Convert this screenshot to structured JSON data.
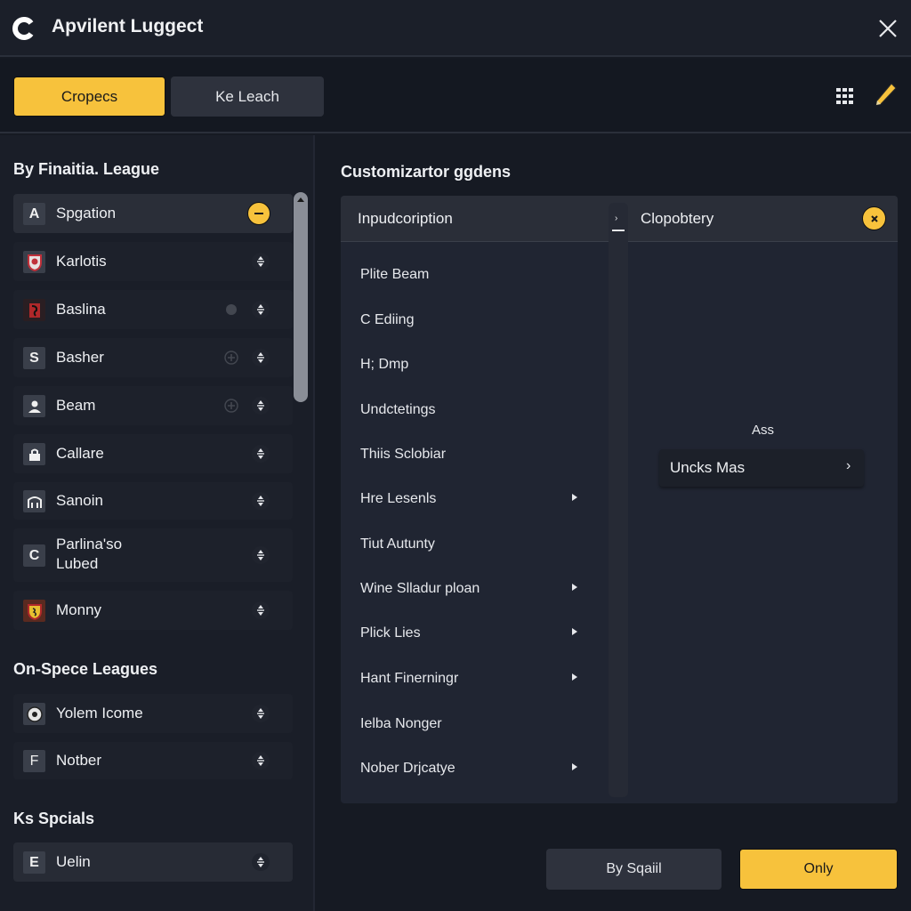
{
  "window": {
    "title": "Apvilent Luggect",
    "logo_icon": "c-logo-icon",
    "close_icon": "close-icon"
  },
  "toolbar": {
    "tabs": [
      {
        "label": "Cropecs",
        "active": true
      },
      {
        "label": "Ke Leach",
        "active": false
      }
    ],
    "grid_icon": "grid-icon",
    "edit_icon": "pencil-icon"
  },
  "sidebar": {
    "sections": [
      {
        "title": "By Finaitia. League",
        "items": [
          {
            "icon": "A",
            "label": "Spgation",
            "selected": true,
            "action": "remove"
          },
          {
            "icon": "crest-red",
            "label": "Karlotis",
            "action": "reorder"
          },
          {
            "icon": "crest-dragon",
            "label": "Baslina",
            "action": "reorder",
            "faint_icon": true
          },
          {
            "icon": "S",
            "label": "Basher",
            "action": "reorder",
            "faint_icon": true
          },
          {
            "icon": "person",
            "label": "Beam",
            "action": "reorder",
            "faint_icon": true
          },
          {
            "icon": "lock",
            "label": "Callare",
            "action": "reorder"
          },
          {
            "icon": "arch",
            "label": "Sanoin",
            "action": "reorder"
          },
          {
            "icon": "C",
            "label": "Parlina'so Lubed",
            "action": "reorder"
          },
          {
            "icon": "crest-yellow",
            "label": "Monny",
            "action": "reorder"
          }
        ]
      },
      {
        "title": "On-Spece Leagues",
        "items": [
          {
            "icon": "ball",
            "label": "Yolem Icome",
            "action": "reorder"
          },
          {
            "icon": "F",
            "label": "Notber",
            "action": "reorder"
          }
        ]
      },
      {
        "title": "Ks Spcials",
        "items": [
          {
            "icon": "E",
            "label": "Uelin",
            "action": "reorder"
          }
        ]
      }
    ]
  },
  "main": {
    "title": "Customizartor ggdens",
    "left_column_header": "Inpudcoription",
    "right_column_header": "Clopobtery",
    "options": [
      {
        "label": "Plite Beam",
        "submenu": false
      },
      {
        "label": "C Ediing",
        "submenu": false
      },
      {
        "label": "H; Dmp",
        "submenu": false
      },
      {
        "label": "Undctetings",
        "submenu": false
      },
      {
        "label": "Thiis Sclobiar",
        "submenu": false
      },
      {
        "label": "Hre Lesenls",
        "submenu": true
      },
      {
        "label": "Tiut Autunty",
        "submenu": false
      },
      {
        "label": "Wine Slladur ploan",
        "submenu": true
      },
      {
        "label": "Plick Lies",
        "submenu": true
      },
      {
        "label": "Hant Finerningr",
        "submenu": true
      },
      {
        "label": "Ielba Nonger",
        "submenu": false
      },
      {
        "label": "Nober Drjcatye",
        "submenu": true
      }
    ],
    "right_panel": {
      "label": "Ass",
      "item_label": "Uncks Mas"
    }
  },
  "footer": {
    "secondary_label": "By Sqaiil",
    "primary_label": "Only"
  },
  "colors": {
    "accent": "#f7c23c",
    "background": "#161a23",
    "panel": "#202532"
  }
}
